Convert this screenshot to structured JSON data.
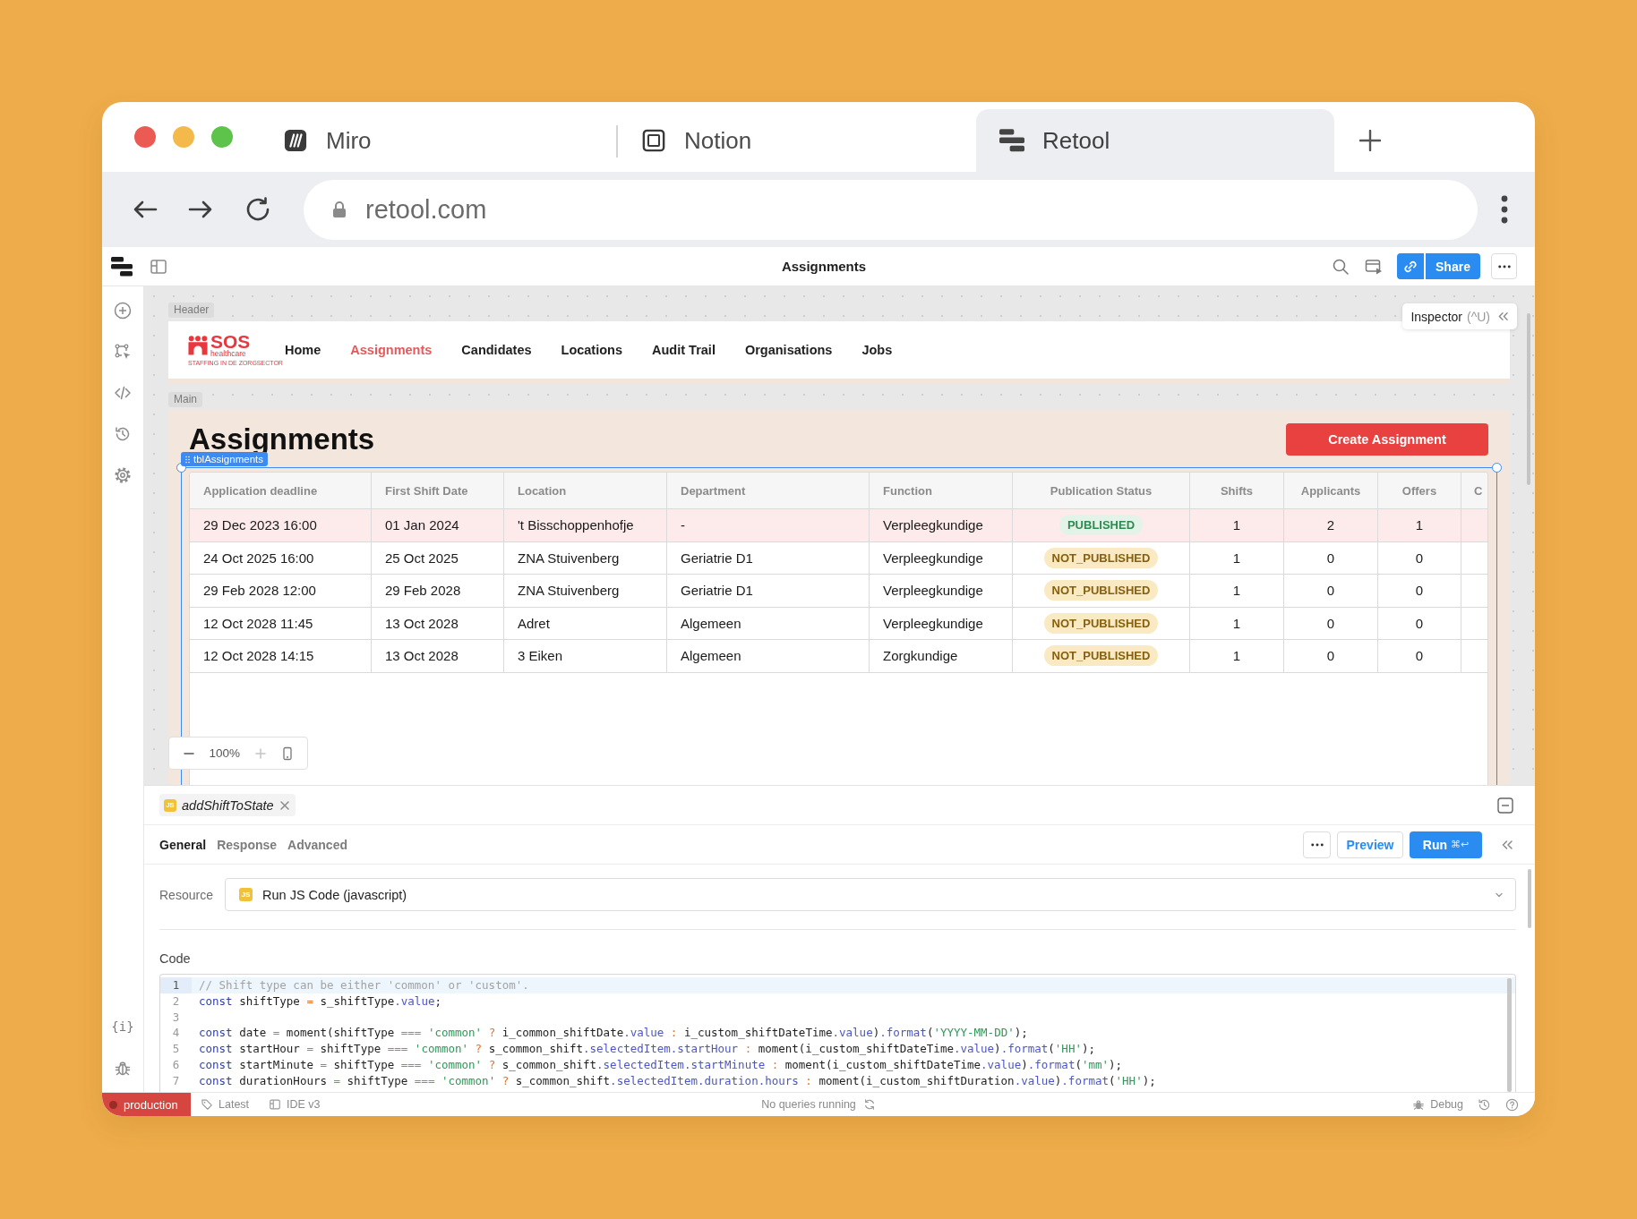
{
  "browser": {
    "tabs": [
      {
        "label": "Miro",
        "selected": false
      },
      {
        "label": "Notion",
        "selected": false
      },
      {
        "label": "Retool",
        "selected": true
      }
    ],
    "url": "retool.com"
  },
  "app_bar": {
    "title": "Assignments",
    "share_button": "Share"
  },
  "sidebar": {
    "state_icon": "{i}"
  },
  "canvas": {
    "inspector": {
      "label": "Inspector",
      "shortcut": "(^U)"
    },
    "header": {
      "tag": "Header",
      "logo": {
        "name": "SOS",
        "subtitle": "healthcare",
        "tagline": "STAFFING IN DE ZORGSECTOR"
      },
      "nav": [
        {
          "label": "Home",
          "selected": false
        },
        {
          "label": "Assignments",
          "selected": true
        },
        {
          "label": "Candidates",
          "selected": false
        },
        {
          "label": "Locations",
          "selected": false
        },
        {
          "label": "Audit Trail",
          "selected": false
        },
        {
          "label": "Organisations",
          "selected": false
        },
        {
          "label": "Jobs",
          "selected": false
        }
      ]
    },
    "main": {
      "tag": "Main",
      "title": "Assignments",
      "create_button": "Create Assignment",
      "table": {
        "tag": "tblAssignments",
        "columns": [
          "Application deadline",
          "First Shift Date",
          "Location",
          "Department",
          "Function",
          "Publication Status",
          "Shifts",
          "Applicants",
          "Offers",
          "C"
        ],
        "rows": [
          {
            "selected": true,
            "application_deadline": "29 Dec 2023 16:00",
            "first_shift_date": "01 Jan 2024",
            "location": "'t Bisschoppenhofje",
            "department": "-",
            "function": "Verpleegkundige",
            "publication_status": {
              "label": "PUBLISHED",
              "kind": "published"
            },
            "shifts": "1",
            "applicants": "2",
            "offers": "1"
          },
          {
            "selected": false,
            "application_deadline": "24 Oct 2025 16:00",
            "first_shift_date": "25 Oct 2025",
            "location": "ZNA Stuivenberg",
            "department": "Geriatrie D1",
            "function": "Verpleegkundige",
            "publication_status": {
              "label": "NOT_PUBLISHED",
              "kind": "not_published"
            },
            "shifts": "1",
            "applicants": "0",
            "offers": "0"
          },
          {
            "selected": false,
            "application_deadline": "29 Feb 2028 12:00",
            "first_shift_date": "29 Feb 2028",
            "location": "ZNA Stuivenberg",
            "department": "Geriatrie D1",
            "function": "Verpleegkundige",
            "publication_status": {
              "label": "NOT_PUBLISHED",
              "kind": "not_published"
            },
            "shifts": "1",
            "applicants": "0",
            "offers": "0"
          },
          {
            "selected": false,
            "application_deadline": "12 Oct 2028 11:45",
            "first_shift_date": "13 Oct 2028",
            "location": "Adret",
            "department": "Algemeen",
            "function": "Verpleegkundige",
            "publication_status": {
              "label": "NOT_PUBLISHED",
              "kind": "not_published"
            },
            "shifts": "1",
            "applicants": "0",
            "offers": "0"
          },
          {
            "selected": false,
            "application_deadline": "12 Oct 2028 14:15",
            "first_shift_date": "13 Oct 2028",
            "location": "3 Eiken",
            "department": "Algemeen",
            "function": "Zorgkundige",
            "publication_status": {
              "label": "NOT_PUBLISHED",
              "kind": "not_published"
            },
            "shifts": "1",
            "applicants": "0",
            "offers": "0"
          }
        ]
      }
    },
    "zoom": {
      "value": "100%",
      "zoom_in": {
        "disabled": true
      }
    }
  },
  "query_panel": {
    "tab": {
      "badge": "JS",
      "name": "addShiftToState"
    },
    "tabs": [
      {
        "label": "General",
        "selected": true
      },
      {
        "label": "Response",
        "selected": false
      },
      {
        "label": "Advanced",
        "selected": false
      }
    ],
    "preview_button": "Preview",
    "run_button": {
      "label": "Run",
      "shortcut": "⌘↩"
    },
    "resource": {
      "label": "Resource",
      "badge": "JS",
      "value": "Run JS Code (javascript)"
    },
    "code": {
      "label": "Code",
      "lines": [
        {
          "number": "1",
          "active": true,
          "tokens": [
            {
              "kind": "comment",
              "text": "// Shift type can be either 'common' or 'custom'."
            }
          ]
        },
        {
          "number": "2",
          "active": false,
          "tokens": [
            {
              "kind": "keyword",
              "text": "const"
            },
            {
              "kind": "plain",
              "text": " shiftType"
            },
            {
              "kind": "operator",
              "text": " = "
            },
            {
              "kind": "plain",
              "text": "s_shiftType"
            },
            {
              "kind": "property",
              "text": ".value"
            },
            {
              "kind": "plain",
              "text": ";"
            }
          ]
        },
        {
          "number": "3",
          "active": false
        },
        {
          "number": "4",
          "active": false,
          "tokens": [
            {
              "kind": "keyword",
              "text": "const"
            },
            {
              "kind": "plain",
              "text": " date"
            },
            {
              "kind": "operator",
              "text": " = "
            },
            {
              "kind": "plain",
              "text": "moment(shiftType"
            },
            {
              "kind": "operator",
              "text": " === "
            },
            {
              "kind": "string",
              "text": "'common'"
            },
            {
              "kind": "operator",
              "text": " ? "
            },
            {
              "kind": "plain",
              "text": "i_common_shiftDate"
            },
            {
              "kind": "property",
              "text": ".value"
            },
            {
              "kind": "operator",
              "text": " : "
            },
            {
              "kind": "plain",
              "text": "i_custom_shiftDateTime"
            },
            {
              "kind": "property",
              "text": ".value"
            },
            {
              "kind": "plain",
              "text": ")"
            },
            {
              "kind": "property",
              "text": ".format"
            },
            {
              "kind": "plain",
              "text": "("
            },
            {
              "kind": "string",
              "text": "'YYYY-MM-DD'"
            },
            {
              "kind": "plain",
              "text": ");"
            }
          ]
        },
        {
          "number": "5",
          "active": false,
          "tokens": [
            {
              "kind": "keyword",
              "text": "const"
            },
            {
              "kind": "plain",
              "text": " startHour"
            },
            {
              "kind": "operator",
              "text": " = "
            },
            {
              "kind": "plain",
              "text": "shiftType"
            },
            {
              "kind": "operator",
              "text": " === "
            },
            {
              "kind": "string",
              "text": "'common'"
            },
            {
              "kind": "operator",
              "text": " ? "
            },
            {
              "kind": "plain",
              "text": "s_common_shift"
            },
            {
              "kind": "property",
              "text": ".selectedItem.startHour"
            },
            {
              "kind": "operator",
              "text": " : "
            },
            {
              "kind": "plain",
              "text": "moment(i_custom_shiftDateTime"
            },
            {
              "kind": "property",
              "text": ".value"
            },
            {
              "kind": "plain",
              "text": ")"
            },
            {
              "kind": "property",
              "text": ".format"
            },
            {
              "kind": "plain",
              "text": "("
            },
            {
              "kind": "string",
              "text": "'HH'"
            },
            {
              "kind": "plain",
              "text": ");"
            }
          ]
        },
        {
          "number": "6",
          "active": false,
          "tokens": [
            {
              "kind": "keyword",
              "text": "const"
            },
            {
              "kind": "plain",
              "text": " startMinute"
            },
            {
              "kind": "operator",
              "text": " = "
            },
            {
              "kind": "plain",
              "text": "shiftType"
            },
            {
              "kind": "operator",
              "text": " === "
            },
            {
              "kind": "string",
              "text": "'common'"
            },
            {
              "kind": "operator",
              "text": " ? "
            },
            {
              "kind": "plain",
              "text": "s_common_shift"
            },
            {
              "kind": "property",
              "text": ".selectedItem.startMinute"
            },
            {
              "kind": "operator",
              "text": " : "
            },
            {
              "kind": "plain",
              "text": "moment(i_custom_shiftDateTime"
            },
            {
              "kind": "property",
              "text": ".value"
            },
            {
              "kind": "plain",
              "text": ")"
            },
            {
              "kind": "property",
              "text": ".format"
            },
            {
              "kind": "plain",
              "text": "("
            },
            {
              "kind": "string",
              "text": "'mm'"
            },
            {
              "kind": "plain",
              "text": ");"
            }
          ]
        },
        {
          "number": "7",
          "active": false,
          "tokens": [
            {
              "kind": "keyword",
              "text": "const"
            },
            {
              "kind": "plain",
              "text": " durationHours"
            },
            {
              "kind": "operator",
              "text": " = "
            },
            {
              "kind": "plain",
              "text": "shiftType"
            },
            {
              "kind": "operator",
              "text": " === "
            },
            {
              "kind": "string",
              "text": "'common'"
            },
            {
              "kind": "operator",
              "text": " ? "
            },
            {
              "kind": "plain",
              "text": "s_common_shift"
            },
            {
              "kind": "property",
              "text": ".selectedItem.duration.hours"
            },
            {
              "kind": "operator",
              "text": " : "
            },
            {
              "kind": "plain",
              "text": "moment(i_custom_shiftDuration"
            },
            {
              "kind": "property",
              "text": ".value"
            },
            {
              "kind": "plain",
              "text": ")"
            },
            {
              "kind": "property",
              "text": ".format"
            },
            {
              "kind": "plain",
              "text": "("
            },
            {
              "kind": "string",
              "text": "'HH'"
            },
            {
              "kind": "plain",
              "text": ");"
            }
          ]
        }
      ]
    }
  },
  "status_bar": {
    "environment": "production",
    "release": "Latest",
    "ide": "IDE v3",
    "query_status": "No queries running",
    "debug": "Debug"
  }
}
